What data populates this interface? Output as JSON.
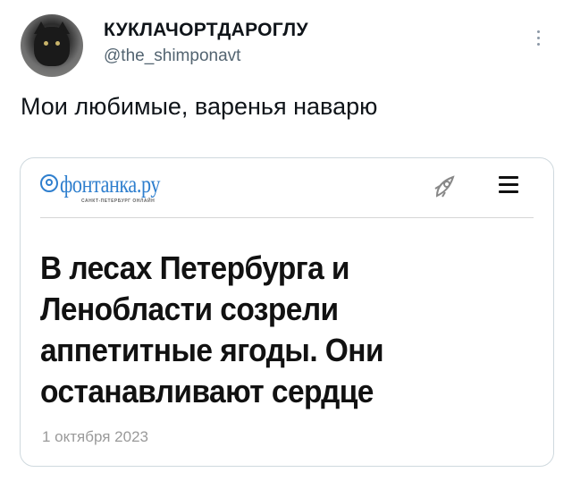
{
  "tweet": {
    "display_name": "КУКЛАЧОРТДАРОГЛУ",
    "handle": "@the_shimponavt",
    "text": "Мои любимые, варенья наварю"
  },
  "card": {
    "brand_name": "фонтанка.ру",
    "brand_tagline": "САНКТ-ПЕТЕРБУРГ ОНЛАЙН",
    "headline": "В лесах Петербурга и Ленобласти созрели аппетитные ягоды. Они останавливают сердце",
    "date": "1 октября 2023",
    "accent_color": "#2f7fce"
  },
  "icons": {
    "avatar": "cat-avatar",
    "more": "more-vertical-icon",
    "rocket": "rocket-icon",
    "menu": "hamburger-menu-icon"
  }
}
